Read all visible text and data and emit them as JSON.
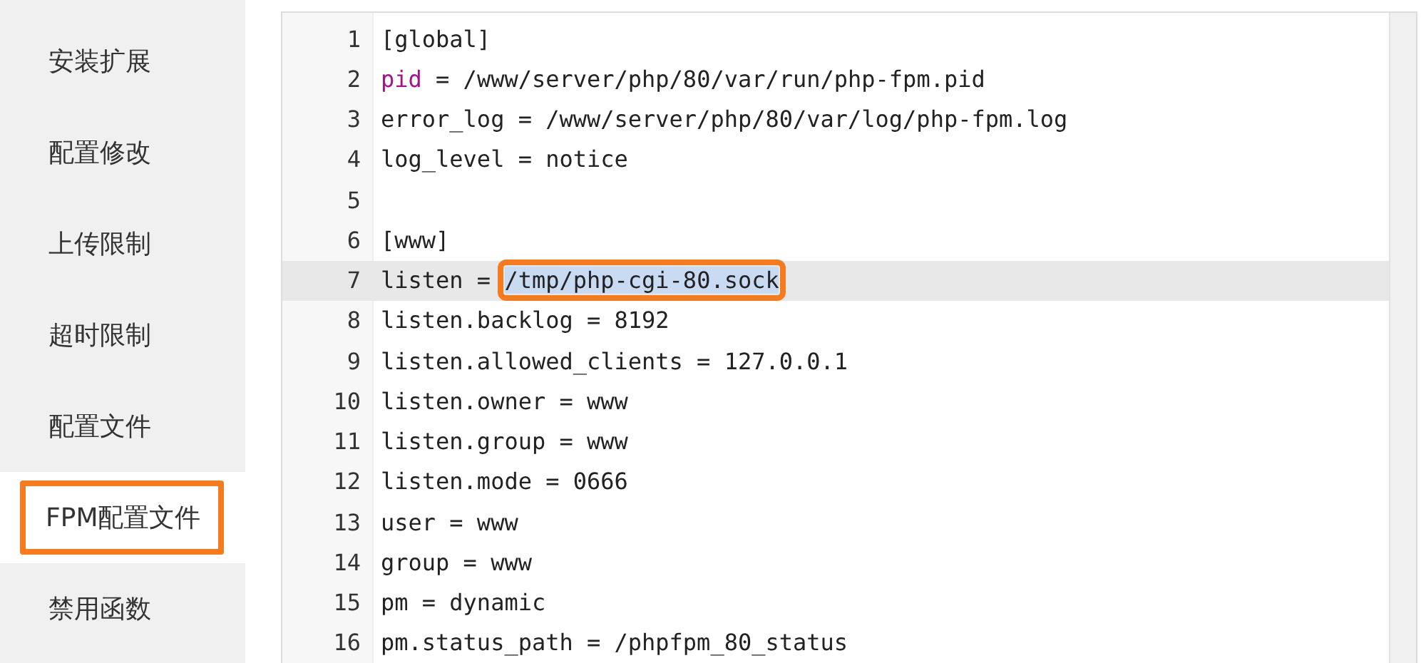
{
  "sidebar": {
    "items": [
      {
        "label": "安装扩展",
        "selected": false,
        "highlighted": false
      },
      {
        "label": "配置修改",
        "selected": false,
        "highlighted": false
      },
      {
        "label": "上传限制",
        "selected": false,
        "highlighted": false
      },
      {
        "label": "超时限制",
        "selected": false,
        "highlighted": false
      },
      {
        "label": "配置文件",
        "selected": false,
        "highlighted": false
      },
      {
        "label": "FPM配置文件",
        "selected": true,
        "highlighted": true
      },
      {
        "label": "禁用函数",
        "selected": false,
        "highlighted": false
      }
    ]
  },
  "editor": {
    "lines": [
      {
        "number": "1",
        "active": false,
        "segments": [
          {
            "text": "[global]",
            "kind": "plain"
          }
        ]
      },
      {
        "number": "2",
        "active": false,
        "segments": [
          {
            "text": "pid",
            "kind": "keyword"
          },
          {
            "text": " = /www/server/php/80/var/run/php-fpm.pid",
            "kind": "plain"
          }
        ]
      },
      {
        "number": "3",
        "active": false,
        "segments": [
          {
            "text": "error_log = /www/server/php/80/var/log/php-fpm.log",
            "kind": "plain"
          }
        ]
      },
      {
        "number": "4",
        "active": false,
        "segments": [
          {
            "text": "log_level = notice",
            "kind": "plain"
          }
        ]
      },
      {
        "number": "5",
        "active": false
      },
      {
        "number": "6",
        "active": false,
        "segments": [
          {
            "text": "[www]",
            "kind": "plain"
          }
        ]
      },
      {
        "number": "7",
        "active": true,
        "segments": [
          {
            "text": "listen = ",
            "kind": "plain"
          },
          {
            "text": "/tmp/php-cgi-80.sock",
            "kind": "selected"
          }
        ]
      },
      {
        "number": "8",
        "active": false,
        "segments": [
          {
            "text": "listen.backlog = 8192",
            "kind": "plain"
          }
        ]
      },
      {
        "number": "9",
        "active": false,
        "segments": [
          {
            "text": "listen.allowed_clients = 127.0.0.1",
            "kind": "plain"
          }
        ]
      },
      {
        "number": "10",
        "active": false,
        "segments": [
          {
            "text": "listen.owner = www",
            "kind": "plain"
          }
        ]
      },
      {
        "number": "11",
        "active": false,
        "segments": [
          {
            "text": "listen.group = www",
            "kind": "plain"
          }
        ]
      },
      {
        "number": "12",
        "active": false,
        "segments": [
          {
            "text": "listen.mode = 0666",
            "kind": "plain"
          }
        ]
      },
      {
        "number": "13",
        "active": false,
        "segments": [
          {
            "text": "user = www",
            "kind": "plain"
          }
        ]
      },
      {
        "number": "14",
        "active": false,
        "segments": [
          {
            "text": "group = www",
            "kind": "plain"
          }
        ]
      },
      {
        "number": "15",
        "active": false,
        "segments": [
          {
            "text": "pm = dynamic",
            "kind": "plain"
          }
        ]
      },
      {
        "number": "16",
        "active": false,
        "segments": [
          {
            "text": "pm.status_path = /phpfpm_80_status",
            "kind": "plain"
          }
        ]
      }
    ]
  }
}
